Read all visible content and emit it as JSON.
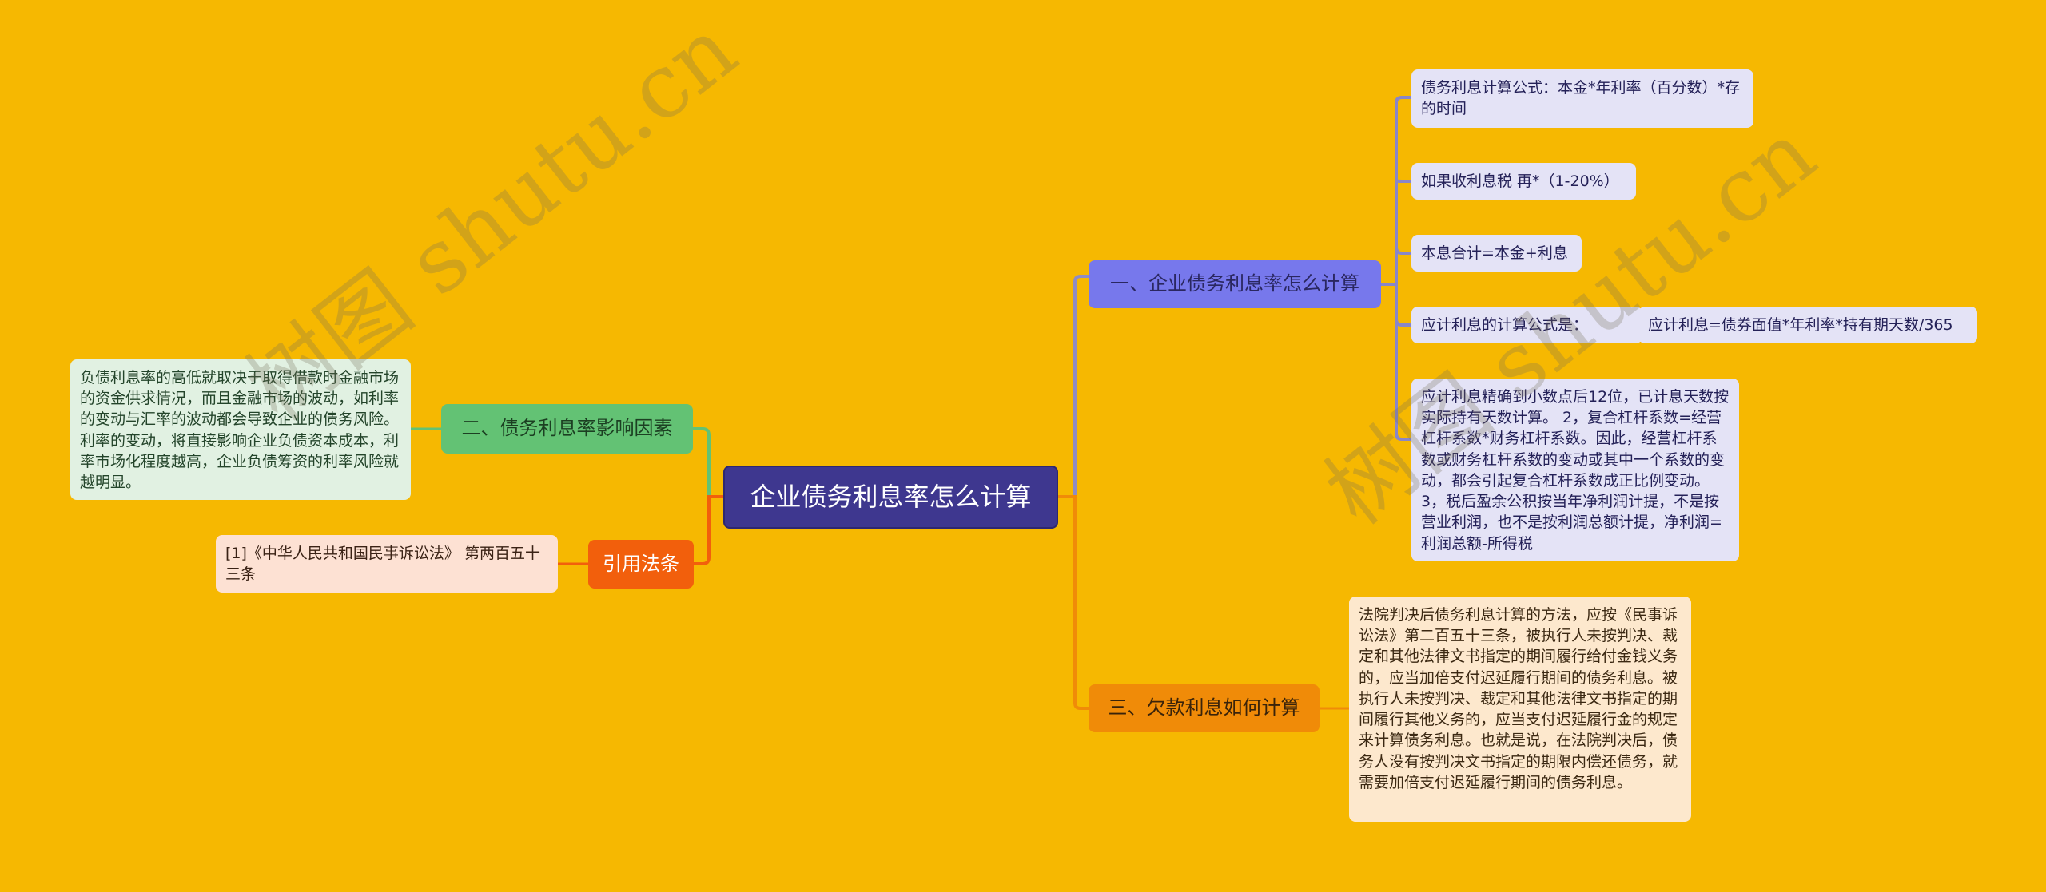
{
  "mindmap": {
    "root": {
      "label": "企业债务利息率怎么计算"
    },
    "branches": [
      {
        "label": "一、企业债务利息率怎么计算",
        "color": "#7778ec",
        "children": [
          {
            "label": "债务利息计算公式：本金*年利率（百分数）*存的时间"
          },
          {
            "label": "如果收利息税 再*（1-20%）"
          },
          {
            "label": "本息合计=本金+利息"
          },
          {
            "label": "应计利息的计算公式是：",
            "children": [
              {
                "label": "应计利息=债券面值*年利率*持有期天数/365"
              }
            ]
          },
          {
            "label": "应计利息精确到小数点后12位，已计息天数按实际持有天数计算。  2，复合杠杆系数=经营杠杆系数*财务杠杆系数。因此，经营杠杆系数或财务杠杆系数的变动或其中一个系数的变动，都会引起复合杠杆系数成正比例变动。  3，税后盈余公积按当年净利润计提，不是按营业利润，也不是按利润总额计提，净利润=利润总额-所得税"
          }
        ]
      },
      {
        "label": "二、债务利息率影响因素",
        "color": "#63c274",
        "children": [
          {
            "label": "负债利息率的高低就取决于取得借款时金融市场的资金供求情况，而且金融市场的波动，如利率的变动与汇率的波动都会导致企业的债务风险。利率的变动，将直接影响企业负债资本成本，利率市场化程度越高，企业负债筹资的利率风险就越明显。"
          }
        ]
      },
      {
        "label": "引用法条",
        "color": "#f25f0c",
        "children": [
          {
            "label": "[1]《中华人民共和国民事诉讼法》 第两百五十三条"
          }
        ]
      },
      {
        "label": "三、欠款利息如何计算",
        "color": "#f08b08",
        "children": [
          {
            "label": "法院判决后债务利息计算的方法，应按《民事诉讼法》第二百五十三条，被执行人未按判决、裁定和其他法律文书指定的期间履行给付金钱义务的，应当加倍支付迟延履行期间的债务利息。被执行人未按判决、裁定和其他法律文书指定的期间履行其他义务的，应当支付迟延履行金的规定来计算债务利息。也就是说，在法院判决后，债务人没有按判决文书指定的期限内偿还债务，就需要加倍支付迟延履行期间的债务利息。"
          }
        ]
      }
    ]
  },
  "watermark": {
    "text": "树图 shutu.cn"
  },
  "colors": {
    "background": "#f6b801",
    "root": "#3e378f",
    "link_blue": "#7a78c0",
    "link_green": "#63c274",
    "link_red": "#f25f0c",
    "link_orange": "#f08b08"
  }
}
